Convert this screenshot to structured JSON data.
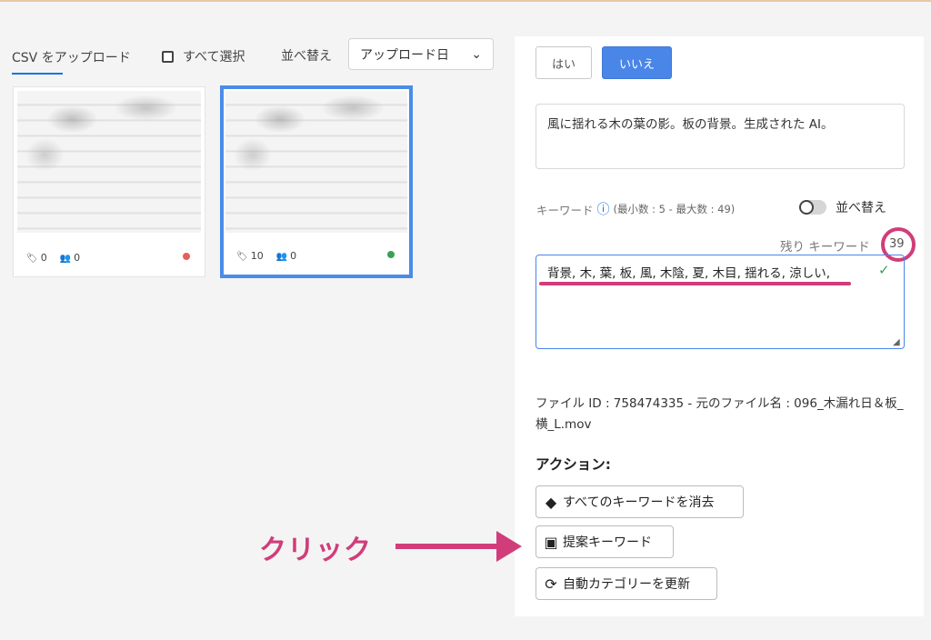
{
  "toolbar": {
    "csv_upload_tab": "CSV をアップロード",
    "select_all_label": "すべて選択",
    "sort_label": "並べ替え",
    "sort_selected": "アップロード日"
  },
  "thumbnails": [
    {
      "keywords": "0",
      "people": "0",
      "status_color": "#e5605a",
      "selected": false
    },
    {
      "keywords": "10",
      "people": "0",
      "status_color": "#3aa153",
      "selected": true
    }
  ],
  "panel": {
    "yes_label": "はい",
    "no_label": "いいえ",
    "title_text": "風に揺れる木の葉の影。板の背景。生成された AI。",
    "keywords_label": "キーワード",
    "keywords_minmax": "(最小数 : 5 - 最大数 : 49)",
    "sort_toggle_label": "並べ替え",
    "remaining_label": "残り キーワード",
    "remaining_count": "39",
    "keywords_text": "背景, 木, 葉, 板, 風, 木陰, 夏, 木目, 揺れる, 涼しい,",
    "file_info": "ファイル ID : 758474335 - 元のファイル名 : 096_木漏れ日＆板_横_L.mov",
    "actions_title": "アクション:",
    "action_clear": "すべてのキーワードを消去",
    "action_suggest": "提案キーワード",
    "action_category": "自動カテゴリーを更新"
  },
  "annotation": {
    "click_label": "クリック"
  },
  "colors": {
    "accent": "#4a86e8",
    "highlight": "#d13d7a"
  }
}
